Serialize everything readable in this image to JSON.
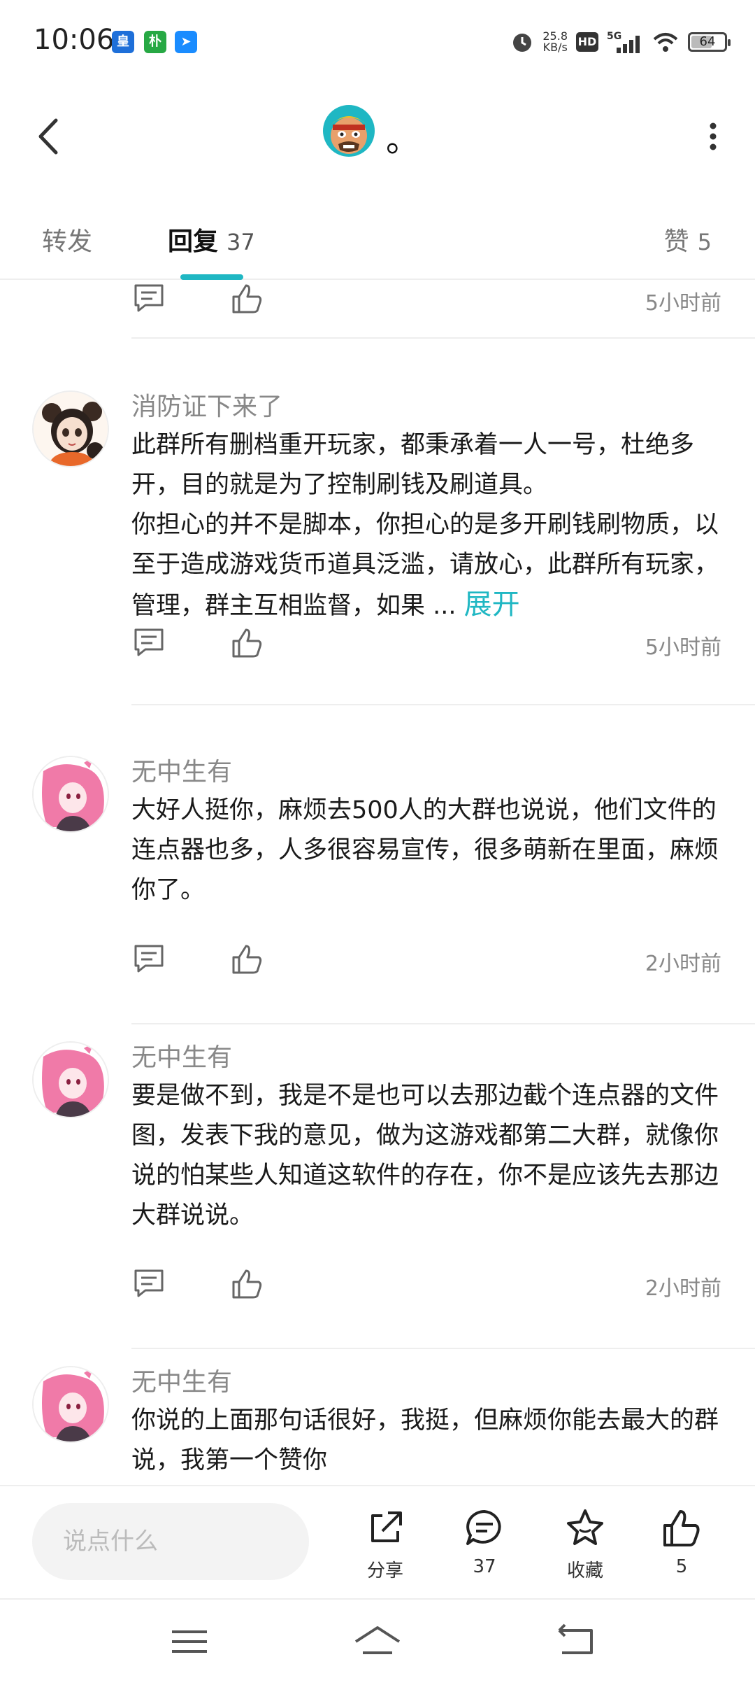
{
  "status_bar": {
    "time": "10:06",
    "app_icons": [
      "皇港",
      "朴",
      "➤"
    ],
    "net_speed_value": "25.8",
    "net_speed_unit": "KB/s",
    "hd": "HD",
    "network": "5G",
    "battery": "64",
    "battery_level": 0.64
  },
  "header": {
    "title": "。"
  },
  "tabs": {
    "forward_label": "转发",
    "reply_label": "回复",
    "reply_count": "37",
    "like_label": "赞",
    "like_count": "5"
  },
  "comments": [
    {
      "time": "5小时前"
    },
    {
      "name": "消防证下来了",
      "text": "此群所有删档重开玩家，都秉承着一人一号，杜绝多开，目的就是为了控制刷钱及刷道具。\n你担心的并不是脚本，你担心的是多开刷钱刷物质，以至于造成游戏货币道具泛滥，请放心，此群所有玩家，管理，群主互相监督，如果 ...",
      "expand": "展开",
      "time": "5小时前"
    },
    {
      "name": "无中生有",
      "text": "大好人挺你，麻烦去500人的大群也说说，他们文件的连点器也多，人多很容易宣传，很多萌新在里面，麻烦你了。",
      "time": "2小时前"
    },
    {
      "name": "无中生有",
      "text": "要是做不到，我是不是也可以去那边截个连点器的文件图，发表下我的意见，做为这游戏都第二大群，就像你说的怕某些人知道这软件的存在，你不是应该先去那边大群说说。",
      "time": "2小时前"
    },
    {
      "name": "无中生有",
      "text": "你说的上面那句话很好，我挺，但麻烦你能去最大的群说，我第一个赞你"
    }
  ],
  "bottom_bar": {
    "input_placeholder": "说点什么",
    "share_label": "分享",
    "comment_count": "37",
    "favorite_label": "收藏",
    "like_count": "5"
  },
  "colors": {
    "accent": "#1fb7c3",
    "text": "#1a1a1a",
    "muted": "#888888"
  }
}
